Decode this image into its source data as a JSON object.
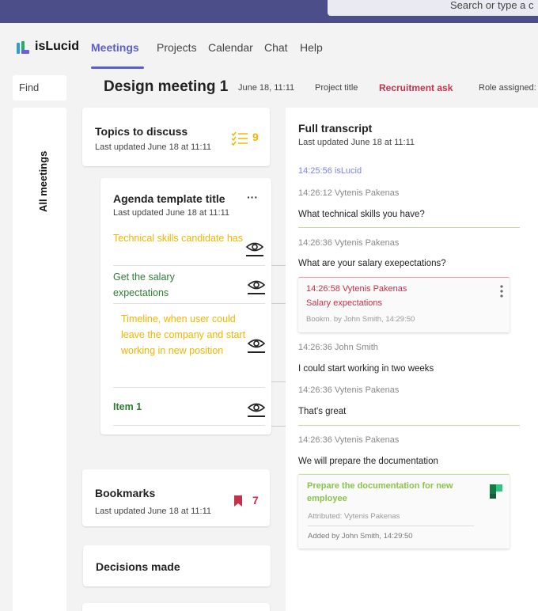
{
  "search": {
    "placeholder": "Search or type a c"
  },
  "app": {
    "name": "isLucid"
  },
  "nav": [
    "Meetings",
    "Projects",
    "Calendar",
    "Chat",
    "Help"
  ],
  "find": {
    "placeholder": "Find"
  },
  "header": {
    "title": "Design meeting 1",
    "date": "June 18, 11:11",
    "project": "Project title",
    "recruitment": "Recruitment ask",
    "role": "Role assigned:"
  },
  "sidebar": {
    "label": "All meetings"
  },
  "topics": {
    "title": "Topics to discuss",
    "updated": "Last updated June 18 at 11:11",
    "count": "9"
  },
  "agenda": {
    "title": "Agenda template title",
    "updated": "Last updated June 18 at 11:11",
    "more": "···",
    "items": [
      {
        "text": "Technical skills candidate has",
        "color": "#f2b600"
      },
      {
        "text": "Get the salary expectations",
        "color": "#2e7d32"
      },
      {
        "text": "Timeline, when user could leave the company and start working in new position",
        "color": "#f2b600"
      },
      {
        "text": "Item 1",
        "color": "#2e7d32"
      }
    ]
  },
  "bookmarks": {
    "title": "Bookmarks",
    "updated": "Last updated June 18 at 11:11",
    "count": "7"
  },
  "decisions": {
    "title": "Decisions made"
  },
  "transcript": {
    "title": "Full transcript",
    "updated": "Last updated June 18 at 11:11",
    "entries": [
      {
        "time": "14:25:56 isLucid"
      },
      {
        "time": "14:26:12 Vytenis Pakenas",
        "text": "What technical skills you have?"
      },
      {
        "time": "14:26:36 Vytenis Pakenas",
        "text": "What are your salary exepectations?"
      },
      {
        "time": "14:26:36 John Smith",
        "text": "I could start working in two weeks"
      },
      {
        "time": "14:26:36 Vytenis Pakenas",
        "text": "That's great"
      },
      {
        "time": "14:26:36 Vytenis Pakenas",
        "text": "We will prepare the documentation"
      }
    ],
    "bookmark": {
      "time": "14:26:58 Vytenis Pakenas",
      "label": "Salary expectations",
      "by": "Bookm. by John Smith, 14:29:50"
    },
    "task": {
      "title": "Prepare the documentation for new employee",
      "attributed": "Attributed: Vytenis Pakenas",
      "added": "Added by John Smith, 14:29:50"
    }
  },
  "colors": {
    "accent": "#5b5fc7",
    "topbar": "#4b4e89",
    "red": "#c4314b",
    "yellow": "#f2b600",
    "green": "#2e7d32",
    "task-green": "#8bc34a"
  }
}
